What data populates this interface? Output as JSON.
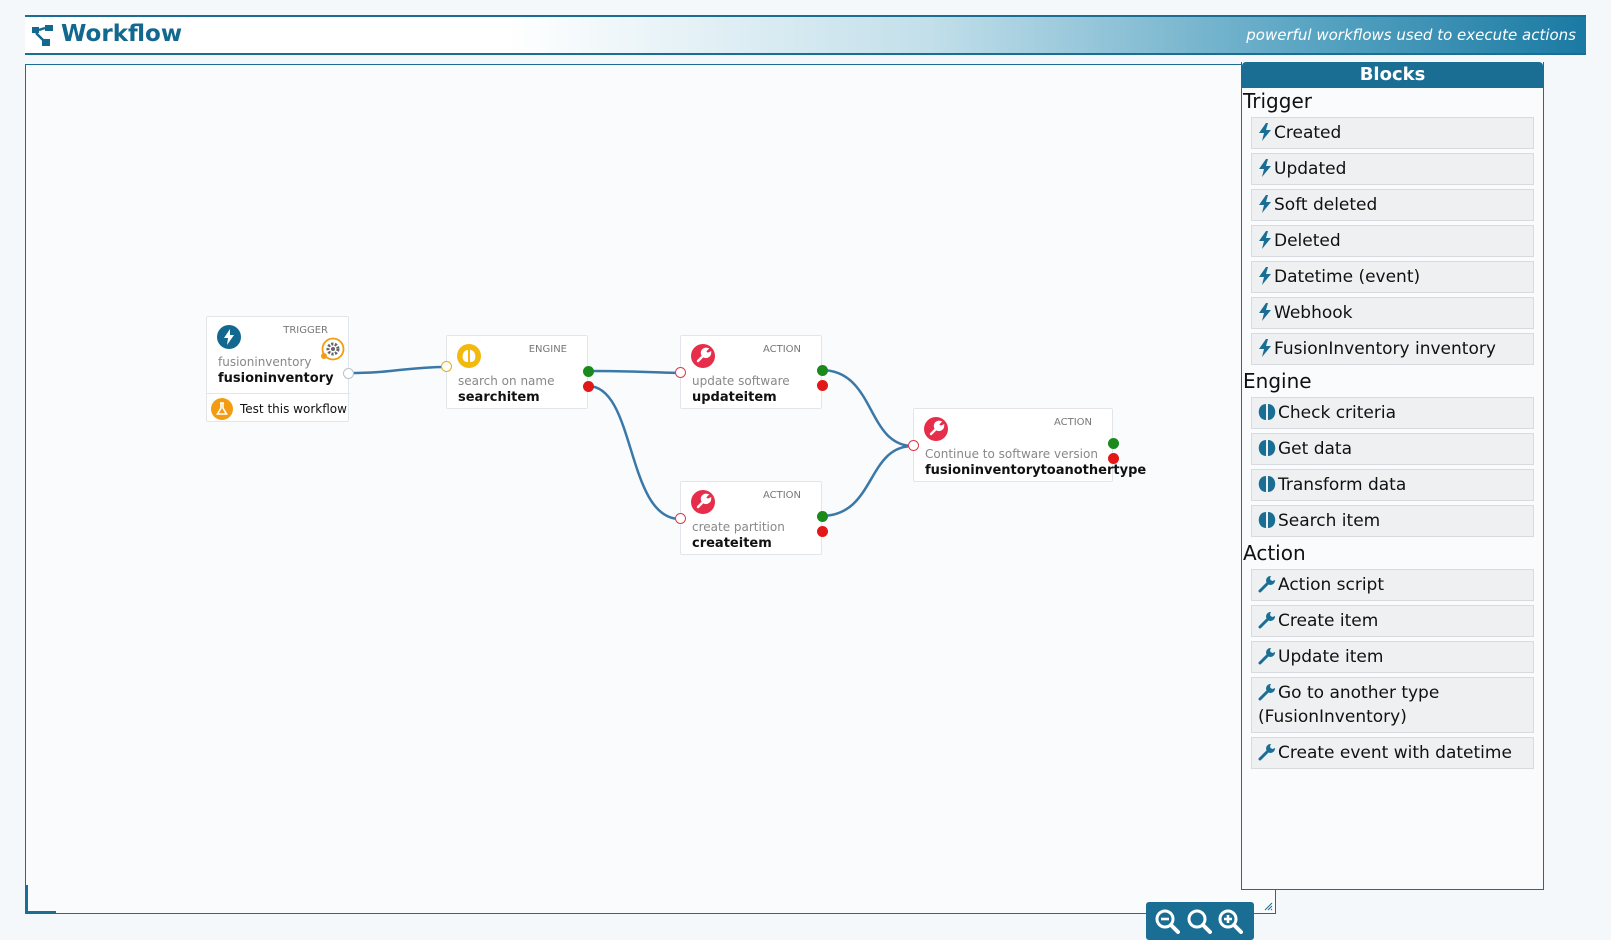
{
  "header": {
    "title": "Workflow",
    "subtitle": "powerful workflows used to execute actions"
  },
  "nodes": {
    "trigger": {
      "type": "TRIGGER",
      "desc": "fusioninventory",
      "name": "fusioninventory",
      "test_label": "Test this workflow"
    },
    "engine": {
      "type": "ENGINE",
      "desc": "search on name",
      "name": "searchitem"
    },
    "update": {
      "type": "ACTION",
      "desc": "update software",
      "name": "updateitem"
    },
    "create": {
      "type": "ACTION",
      "desc": "create partition",
      "name": "createitem"
    },
    "another": {
      "type": "ACTION",
      "desc": "Continue to software version",
      "name": "fusioninventorytoanothertype"
    }
  },
  "blocks": {
    "title": "Blocks",
    "sections": [
      {
        "label": "Trigger",
        "icon": "bolt-icon",
        "items": [
          "Created",
          "Updated",
          "Soft deleted",
          "Deleted",
          "Datetime (event)",
          "Webhook",
          "FusionInventory inventory"
        ]
      },
      {
        "label": "Engine",
        "icon": "brain-icon",
        "items": [
          "Check criteria",
          "Get data",
          "Transform data",
          "Search item"
        ]
      },
      {
        "label": "Action",
        "icon": "wrench-icon",
        "items": [
          "Action script",
          "Create item",
          "Update item",
          "Go to another type (FusionInventory)",
          "Create event with datetime"
        ]
      }
    ]
  },
  "zoom": {
    "icons": [
      "zoom-out-icon",
      "zoom-reset-icon",
      "zoom-in-icon"
    ]
  },
  "colors": {
    "primary": "#1a6e94",
    "trigger": "#12688f",
    "engine": "#f2b90f",
    "action": "#e62e4a",
    "ok": "#1a8a1a",
    "ko": "#e01818",
    "test": "#f39c12"
  }
}
